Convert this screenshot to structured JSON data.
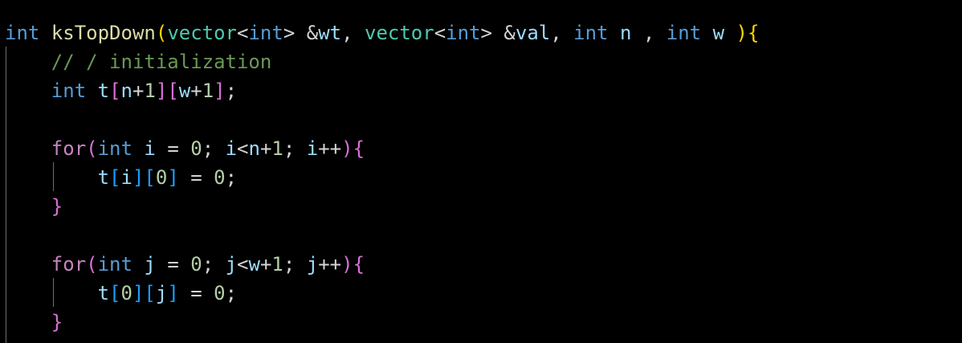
{
  "editor": {
    "language": "cpp",
    "theme_background": "#000000",
    "colors": {
      "keyword": "#569cd6",
      "control_keyword": "#c586c0",
      "function": "#dcdcaa",
      "type": "#4ec9b0",
      "variable": "#9cdcfe",
      "number": "#b5cea8",
      "comment": "#6a9955",
      "bracket_level1": "#ffd700",
      "bracket_level2": "#da70d6",
      "bracket_level3": "#179fff"
    },
    "lines": [
      {
        "tokens": [
          {
            "t": "int",
            "k": "kw"
          },
          {
            "t": " ",
            "k": "pl"
          },
          {
            "t": "ksTopDown",
            "k": "fn"
          },
          {
            "t": "(",
            "k": "b1"
          },
          {
            "t": "vector",
            "k": "ty"
          },
          {
            "t": "<",
            "k": "pl"
          },
          {
            "t": "int",
            "k": "kw"
          },
          {
            "t": "> ",
            "k": "pl"
          },
          {
            "t": "&",
            "k": "pl"
          },
          {
            "t": "wt",
            "k": "var"
          },
          {
            "t": ", ",
            "k": "pl"
          },
          {
            "t": "vector",
            "k": "ty"
          },
          {
            "t": "<",
            "k": "pl"
          },
          {
            "t": "int",
            "k": "kw"
          },
          {
            "t": "> ",
            "k": "pl"
          },
          {
            "t": "&",
            "k": "pl"
          },
          {
            "t": "val",
            "k": "var"
          },
          {
            "t": ", ",
            "k": "pl"
          },
          {
            "t": "int",
            "k": "kw"
          },
          {
            "t": " ",
            "k": "pl"
          },
          {
            "t": "n",
            "k": "var"
          },
          {
            "t": " , ",
            "k": "pl"
          },
          {
            "t": "int",
            "k": "kw"
          },
          {
            "t": " ",
            "k": "pl"
          },
          {
            "t": "w",
            "k": "var"
          },
          {
            "t": " ",
            "k": "pl"
          },
          {
            "t": ")",
            "k": "b1"
          },
          {
            "t": "{",
            "k": "b1"
          }
        ]
      },
      {
        "tokens": [
          {
            "t": "    ",
            "k": "pl"
          },
          {
            "t": "// / initialization",
            "k": "cm"
          }
        ]
      },
      {
        "tokens": [
          {
            "t": "    ",
            "k": "pl"
          },
          {
            "t": "int",
            "k": "kw"
          },
          {
            "t": " ",
            "k": "pl"
          },
          {
            "t": "t",
            "k": "var"
          },
          {
            "t": "[",
            "k": "b2"
          },
          {
            "t": "n",
            "k": "var"
          },
          {
            "t": "+",
            "k": "pl"
          },
          {
            "t": "1",
            "k": "num"
          },
          {
            "t": "]",
            "k": "b2"
          },
          {
            "t": "[",
            "k": "b2"
          },
          {
            "t": "w",
            "k": "var"
          },
          {
            "t": "+",
            "k": "pl"
          },
          {
            "t": "1",
            "k": "num"
          },
          {
            "t": "]",
            "k": "b2"
          },
          {
            "t": ";",
            "k": "pl"
          }
        ]
      },
      {
        "tokens": []
      },
      {
        "tokens": [
          {
            "t": "    ",
            "k": "pl"
          },
          {
            "t": "for",
            "k": "kw2"
          },
          {
            "t": "(",
            "k": "b2"
          },
          {
            "t": "int",
            "k": "kw"
          },
          {
            "t": " ",
            "k": "pl"
          },
          {
            "t": "i",
            "k": "var"
          },
          {
            "t": " = ",
            "k": "pl"
          },
          {
            "t": "0",
            "k": "num"
          },
          {
            "t": "; ",
            "k": "pl"
          },
          {
            "t": "i",
            "k": "var"
          },
          {
            "t": "<",
            "k": "pl"
          },
          {
            "t": "n",
            "k": "var"
          },
          {
            "t": "+",
            "k": "pl"
          },
          {
            "t": "1",
            "k": "num"
          },
          {
            "t": "; ",
            "k": "pl"
          },
          {
            "t": "i",
            "k": "var"
          },
          {
            "t": "++",
            "k": "pl"
          },
          {
            "t": ")",
            "k": "b2"
          },
          {
            "t": "{",
            "k": "b2"
          }
        ]
      },
      {
        "tokens": [
          {
            "t": "        ",
            "k": "pl"
          },
          {
            "t": "t",
            "k": "var"
          },
          {
            "t": "[",
            "k": "b3"
          },
          {
            "t": "i",
            "k": "var"
          },
          {
            "t": "]",
            "k": "b3"
          },
          {
            "t": "[",
            "k": "b3"
          },
          {
            "t": "0",
            "k": "num"
          },
          {
            "t": "]",
            "k": "b3"
          },
          {
            "t": " = ",
            "k": "pl"
          },
          {
            "t": "0",
            "k": "num"
          },
          {
            "t": ";",
            "k": "pl"
          }
        ]
      },
      {
        "tokens": [
          {
            "t": "    ",
            "k": "pl"
          },
          {
            "t": "}",
            "k": "b2"
          }
        ]
      },
      {
        "tokens": []
      },
      {
        "tokens": [
          {
            "t": "    ",
            "k": "pl"
          },
          {
            "t": "for",
            "k": "kw2"
          },
          {
            "t": "(",
            "k": "b2"
          },
          {
            "t": "int",
            "k": "kw"
          },
          {
            "t": " ",
            "k": "pl"
          },
          {
            "t": "j",
            "k": "var"
          },
          {
            "t": " = ",
            "k": "pl"
          },
          {
            "t": "0",
            "k": "num"
          },
          {
            "t": "; ",
            "k": "pl"
          },
          {
            "t": "j",
            "k": "var"
          },
          {
            "t": "<",
            "k": "pl"
          },
          {
            "t": "w",
            "k": "var"
          },
          {
            "t": "+",
            "k": "pl"
          },
          {
            "t": "1",
            "k": "num"
          },
          {
            "t": "; ",
            "k": "pl"
          },
          {
            "t": "j",
            "k": "var"
          },
          {
            "t": "++",
            "k": "pl"
          },
          {
            "t": ")",
            "k": "b2"
          },
          {
            "t": "{",
            "k": "b2"
          }
        ]
      },
      {
        "tokens": [
          {
            "t": "        ",
            "k": "pl"
          },
          {
            "t": "t",
            "k": "var"
          },
          {
            "t": "[",
            "k": "b3"
          },
          {
            "t": "0",
            "k": "num"
          },
          {
            "t": "]",
            "k": "b3"
          },
          {
            "t": "[",
            "k": "b3"
          },
          {
            "t": "j",
            "k": "var"
          },
          {
            "t": "]",
            "k": "b3"
          },
          {
            "t": " = ",
            "k": "pl"
          },
          {
            "t": "0",
            "k": "num"
          },
          {
            "t": ";",
            "k": "pl"
          }
        ]
      },
      {
        "tokens": [
          {
            "t": "    ",
            "k": "pl"
          },
          {
            "t": "}",
            "k": "b2"
          }
        ]
      }
    ]
  }
}
